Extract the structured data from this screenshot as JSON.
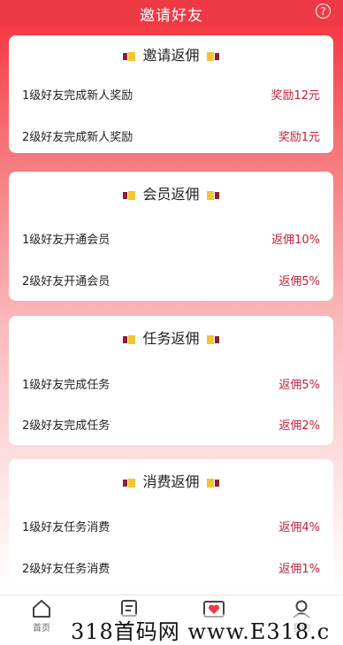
{
  "header": {
    "title": "邀请好友",
    "help_icon": "?"
  },
  "cards": [
    {
      "title": "邀请返佣",
      "rows": [
        {
          "label": "1级好友完成新人奖励",
          "value": "奖励12元"
        },
        {
          "label": "2级好友完成新人奖励",
          "value": "奖励1元"
        }
      ]
    },
    {
      "title": "会员返佣",
      "rows": [
        {
          "label": "1级好友开通会员",
          "value": "返佣10%"
        },
        {
          "label": "2级好友开通会员",
          "value": "返佣5%"
        }
      ]
    },
    {
      "title": "任务返佣",
      "rows": [
        {
          "label": "1级好友完成任务",
          "value": "返佣5%"
        },
        {
          "label": "2级好友完成任务",
          "value": "返佣2%"
        }
      ]
    },
    {
      "title": "消费返佣",
      "rows": [
        {
          "label": "1级好友任务消费",
          "value": "返佣4%"
        },
        {
          "label": "2级好友任务消费",
          "value": "返佣1%"
        }
      ]
    }
  ],
  "tabbar": {
    "tabs": [
      {
        "label": "首页",
        "icon": "home-icon"
      },
      {
        "label": "厅",
        "icon": "hall-icon"
      },
      {
        "label": "",
        "icon": "heart-box-icon"
      },
      {
        "label": "我的",
        "icon": "user-icon"
      }
    ]
  },
  "watermark": "318首码网 www.E318.c"
}
